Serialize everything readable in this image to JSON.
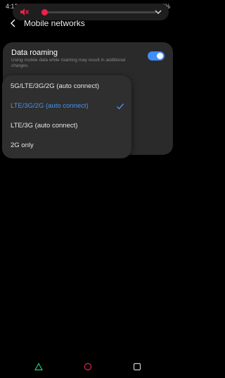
{
  "status_bar": {
    "time": "4:12",
    "battery": "55%"
  },
  "volume_panel": {
    "level": 0.0,
    "accent_color": "#e8224a",
    "icons": [
      "mute-icon",
      "chevron-down-icon"
    ]
  },
  "header": {
    "title": "Mobile networks",
    "back_icon": "chevron-left-icon"
  },
  "settings": {
    "data_roaming": {
      "title": "Data roaming",
      "description": "Using mobile data while roaming may result in additional charges.",
      "enabled": true,
      "toggle_color": "#3e8ef7"
    }
  },
  "network_mode_menu": {
    "options": [
      {
        "label": "5G/LTE/3G/2G (auto connect)",
        "selected": false
      },
      {
        "label": "LTE/3G/2G (auto connect)",
        "selected": true
      },
      {
        "label": "LTE/3G (auto connect)",
        "selected": false
      },
      {
        "label": "2G only",
        "selected": false
      }
    ],
    "selected_color": "#4a90e8"
  },
  "nav_bar": {
    "buttons": [
      {
        "name": "back-icon",
        "color": "#2ec47a"
      },
      {
        "name": "home-icon",
        "color": "#e8224a"
      },
      {
        "name": "recents-icon",
        "color": "#cccccc"
      }
    ]
  }
}
